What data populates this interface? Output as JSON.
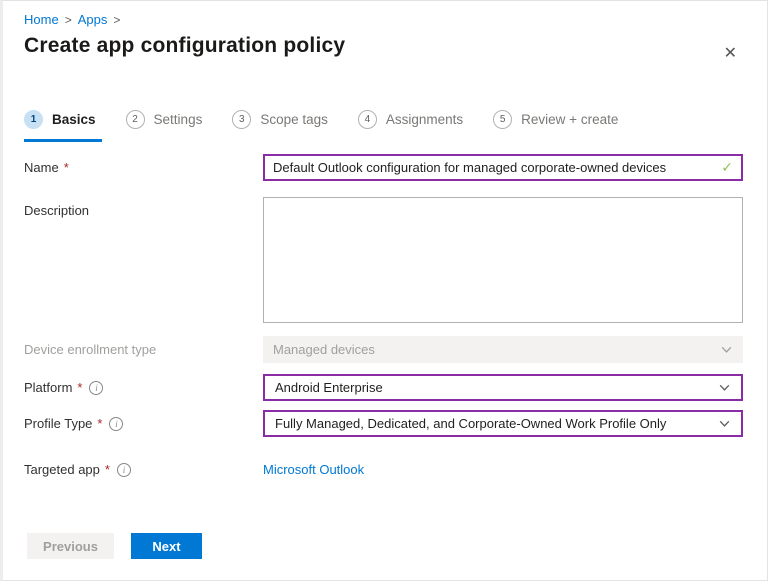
{
  "breadcrumb": {
    "separator": ">",
    "items": [
      {
        "label": "Home"
      },
      {
        "label": "Apps"
      }
    ]
  },
  "header": {
    "title": "Create app configuration policy",
    "close_icon": "✕"
  },
  "steps": [
    {
      "number": "1",
      "label": "Basics"
    },
    {
      "number": "2",
      "label": "Settings"
    },
    {
      "number": "3",
      "label": "Scope tags"
    },
    {
      "number": "4",
      "label": "Assignments"
    },
    {
      "number": "5",
      "label": "Review + create"
    }
  ],
  "form": {
    "name": {
      "label": "Name",
      "required": "*",
      "value": "Default Outlook configuration for managed corporate-owned devices",
      "valid_icon": "✓"
    },
    "description": {
      "label": "Description",
      "value": ""
    },
    "device_enrollment_type": {
      "label": "Device enrollment type",
      "value": "Managed devices"
    },
    "platform": {
      "label": "Platform",
      "required": "*",
      "info_icon": "i",
      "value": "Android Enterprise"
    },
    "profile_type": {
      "label": "Profile Type",
      "required": "*",
      "info_icon": "i",
      "value": "Fully Managed, Dedicated, and Corporate-Owned Work Profile Only"
    },
    "targeted_app": {
      "label": "Targeted app",
      "required": "*",
      "info_icon": "i",
      "link": "Microsoft Outlook"
    }
  },
  "footer": {
    "previous_label": "Previous",
    "next_label": "Next"
  },
  "colors": {
    "accent_blue": "#0078d4",
    "modified_field_border": "#8a2da5",
    "valid_green": "#92c353",
    "required_red": "#a4262c",
    "disabled_bg": "#f3f2f1"
  }
}
